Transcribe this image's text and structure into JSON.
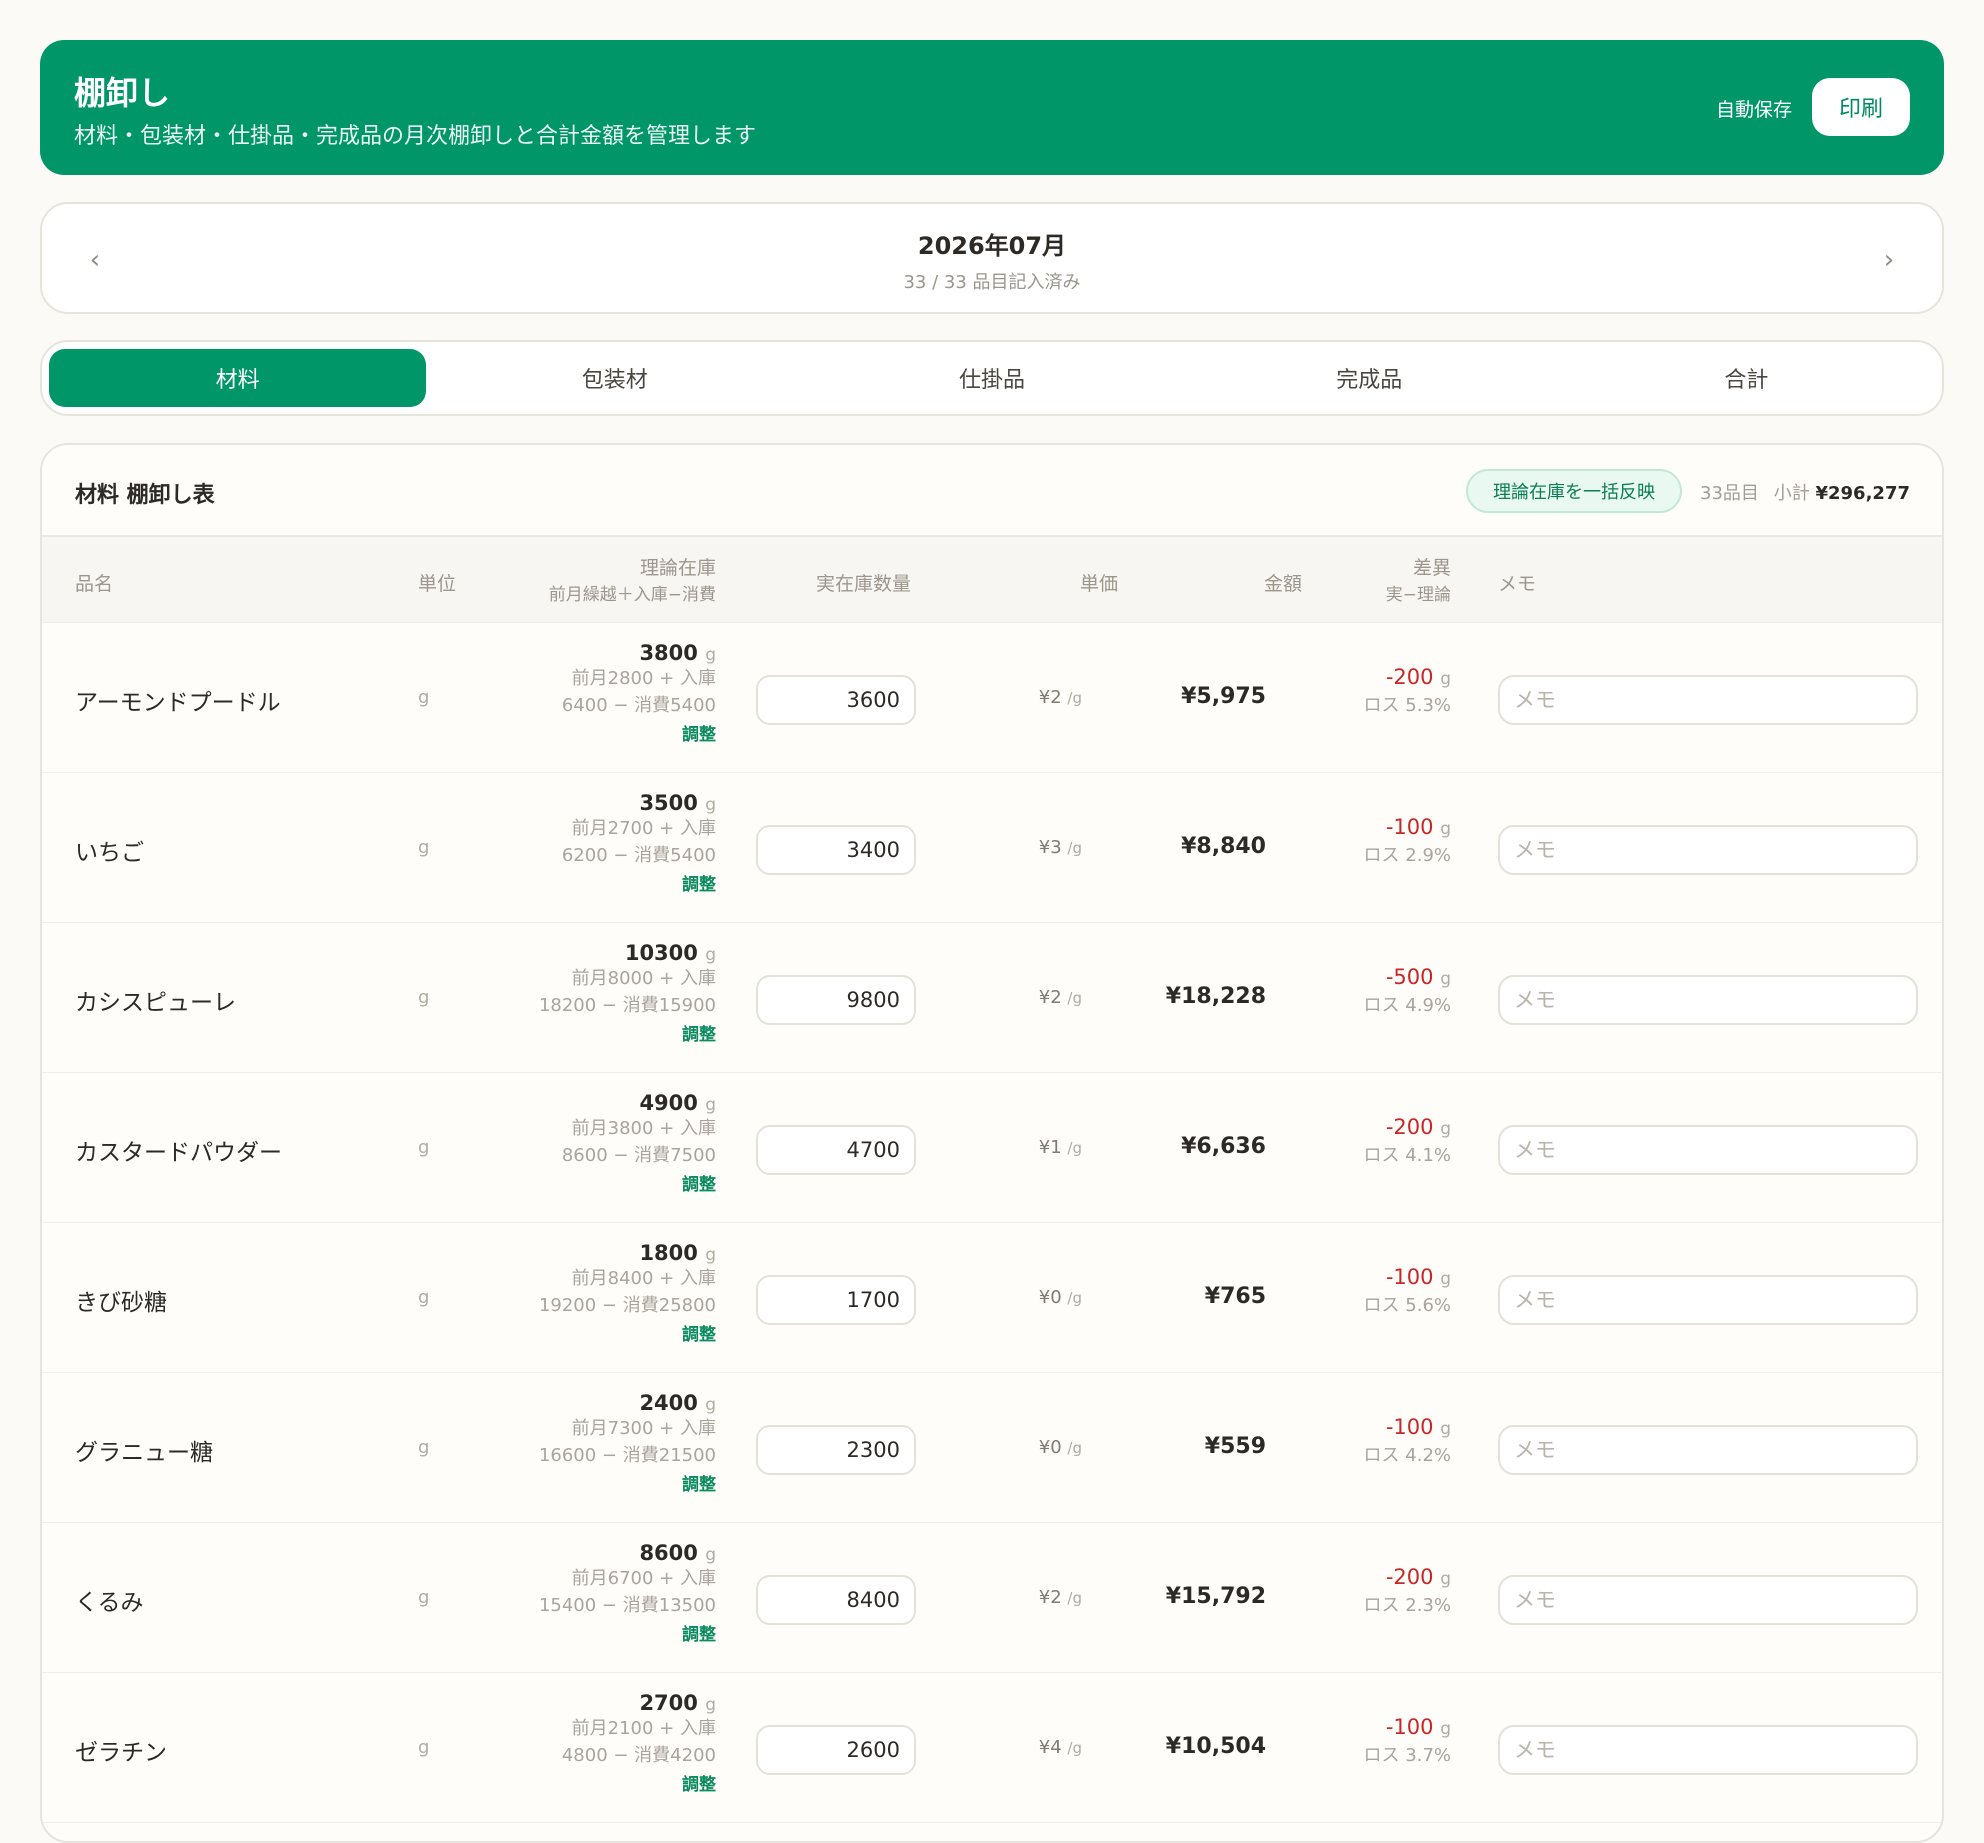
{
  "header": {
    "title": "棚卸し",
    "subtitle": "材料・包装材・仕掛品・完成品の月次棚卸しと合計金額を管理します",
    "autosave": "自動保存",
    "print": "印刷"
  },
  "month": {
    "prev_icon": "‹",
    "next_icon": "›",
    "label": "2026年07月",
    "progress": "33 / 33 品目記入済み"
  },
  "tabs": [
    "材料",
    "包装材",
    "仕掛品",
    "完成品",
    "合計"
  ],
  "table": {
    "title": "材料 棚卸し表",
    "bulk_button": "理論在庫を一括反映",
    "count": "33品目",
    "subtotal_label": "小計",
    "subtotal_value": "¥296,277",
    "columns": {
      "name": "品名",
      "unit": "単位",
      "theo": "理論在庫",
      "theo_sub": "前月繰越＋入庫−消費",
      "actual": "実在庫数量",
      "price": "単価",
      "amount": "金額",
      "diff": "差異",
      "diff_sub": "実−理論",
      "memo": "メモ"
    },
    "adjust_label": "調整",
    "memo_placeholder": "メモ",
    "rows": [
      {
        "name": "アーモンドプードル",
        "unit": "g",
        "theo": "3800",
        "line1": "前月2800 + 入庫",
        "line2": "6400 − 消費5400",
        "actual": "3600",
        "price": "¥2",
        "price_unit": "/g",
        "amount": "¥5,975",
        "diff": "-200",
        "loss": "ロス 5.3%"
      },
      {
        "name": "いちご",
        "unit": "g",
        "theo": "3500",
        "line1": "前月2700 + 入庫",
        "line2": "6200 − 消費5400",
        "actual": "3400",
        "price": "¥3",
        "price_unit": "/g",
        "amount": "¥8,840",
        "diff": "-100",
        "loss": "ロス 2.9%"
      },
      {
        "name": "カシスピューレ",
        "unit": "g",
        "theo": "10300",
        "line1": "前月8000 + 入庫",
        "line2": "18200 − 消費15900",
        "actual": "9800",
        "price": "¥2",
        "price_unit": "/g",
        "amount": "¥18,228",
        "diff": "-500",
        "loss": "ロス 4.9%"
      },
      {
        "name": "カスタードパウダー",
        "unit": "g",
        "theo": "4900",
        "line1": "前月3800 + 入庫",
        "line2": "8600 − 消費7500",
        "actual": "4700",
        "price": "¥1",
        "price_unit": "/g",
        "amount": "¥6,636",
        "diff": "-200",
        "loss": "ロス 4.1%"
      },
      {
        "name": "きび砂糖",
        "unit": "g",
        "theo": "1800",
        "line1": "前月8400 + 入庫",
        "line2": "19200 − 消費25800",
        "actual": "1700",
        "price": "¥0",
        "price_unit": "/g",
        "amount": "¥765",
        "diff": "-100",
        "loss": "ロス 5.6%"
      },
      {
        "name": "グラニュー糖",
        "unit": "g",
        "theo": "2400",
        "line1": "前月7300 + 入庫",
        "line2": "16600 − 消費21500",
        "actual": "2300",
        "price": "¥0",
        "price_unit": "/g",
        "amount": "¥559",
        "diff": "-100",
        "loss": "ロス 4.2%"
      },
      {
        "name": "くるみ",
        "unit": "g",
        "theo": "8600",
        "line1": "前月6700 + 入庫",
        "line2": "15400 − 消費13500",
        "actual": "8400",
        "price": "¥2",
        "price_unit": "/g",
        "amount": "¥15,792",
        "diff": "-200",
        "loss": "ロス 2.3%"
      },
      {
        "name": "ゼラチン",
        "unit": "g",
        "theo": "2700",
        "line1": "前月2100 + 入庫",
        "line2": "4800 − 消費4200",
        "actual": "2600",
        "price": "¥4",
        "price_unit": "/g",
        "amount": "¥10,504",
        "diff": "-100",
        "loss": "ロス 3.7%"
      }
    ]
  }
}
